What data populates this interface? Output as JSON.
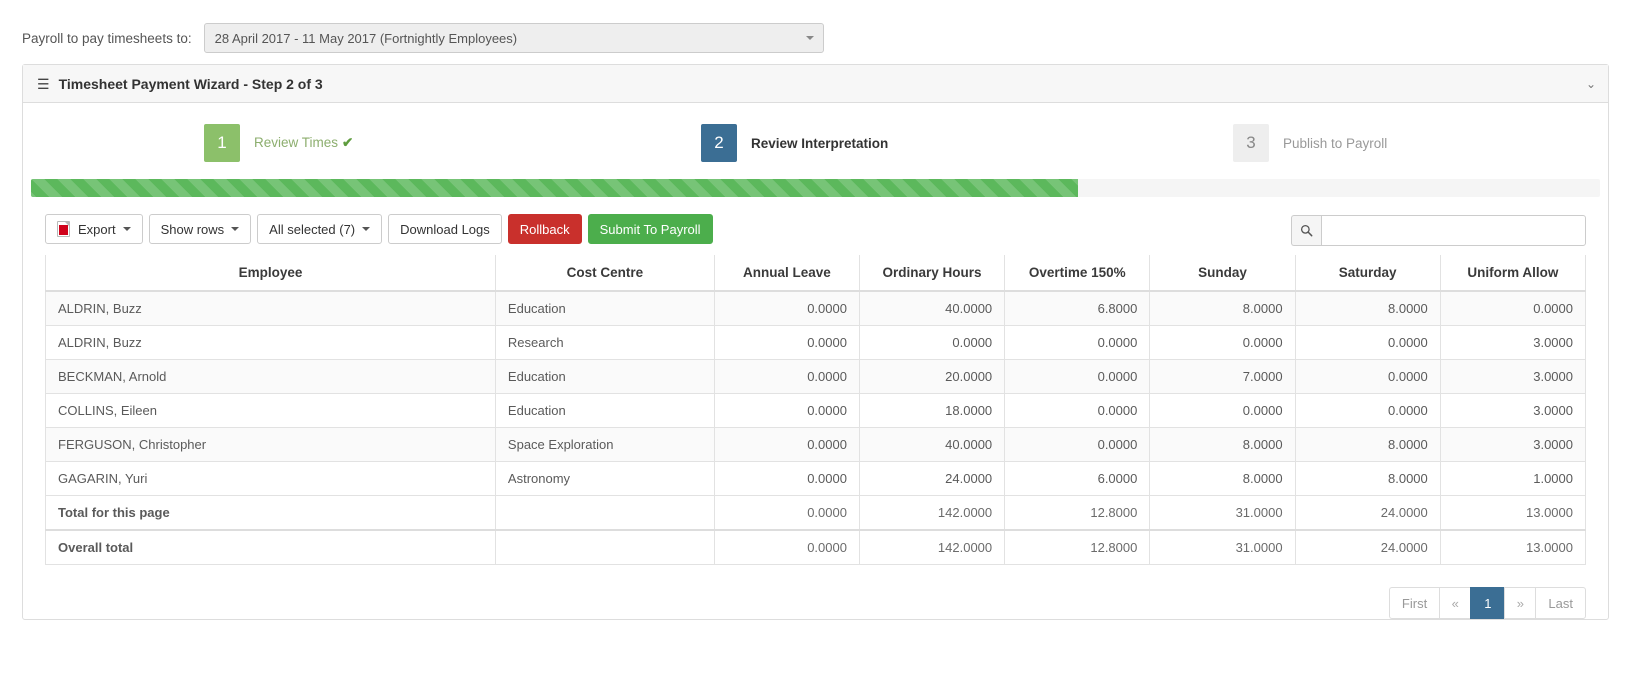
{
  "payroll": {
    "label": "Payroll to pay timesheets to:",
    "selected": "28 April 2017 - 11 May 2017 (Fortnightly Employees)"
  },
  "panel": {
    "title": "Timesheet Payment Wizard - Step 2 of 3",
    "menu_icon": "☰",
    "collapse_icon": "⌄"
  },
  "steps": [
    {
      "number": "1",
      "label": "Review Times",
      "check": "✔"
    },
    {
      "number": "2",
      "label": "Review Interpretation",
      "check": ""
    },
    {
      "number": "3",
      "label": "Publish to Payroll",
      "check": ""
    }
  ],
  "progress": {
    "percent": 66.7
  },
  "toolbar": {
    "export_label": "Export",
    "show_rows_label": "Show rows",
    "all_selected_label": "All selected (7)",
    "download_logs_label": "Download Logs",
    "rollback_label": "Rollback",
    "submit_label": "Submit To Payroll"
  },
  "search": {
    "value": "",
    "placeholder": "",
    "icon": "search-icon"
  },
  "table": {
    "headers": [
      "Employee",
      "Cost Centre",
      "Annual Leave",
      "Ordinary Hours",
      "Overtime 150%",
      "Sunday",
      "Saturday",
      "Uniform Allow"
    ],
    "rows": [
      {
        "employee": "ALDRIN, Buzz",
        "cost_centre": "Education",
        "annual_leave": "0.0000",
        "ordinary_hours": "40.0000",
        "overtime_150": "6.8000",
        "sunday": "8.0000",
        "saturday": "8.0000",
        "uniform_allow": "0.0000"
      },
      {
        "employee": "ALDRIN, Buzz",
        "cost_centre": "Research",
        "annual_leave": "0.0000",
        "ordinary_hours": "0.0000",
        "overtime_150": "0.0000",
        "sunday": "0.0000",
        "saturday": "0.0000",
        "uniform_allow": "3.0000"
      },
      {
        "employee": "BECKMAN, Arnold",
        "cost_centre": "Education",
        "annual_leave": "0.0000",
        "ordinary_hours": "20.0000",
        "overtime_150": "0.0000",
        "sunday": "7.0000",
        "saturday": "0.0000",
        "uniform_allow": "3.0000"
      },
      {
        "employee": "COLLINS, Eileen",
        "cost_centre": "Education",
        "annual_leave": "0.0000",
        "ordinary_hours": "18.0000",
        "overtime_150": "0.0000",
        "sunday": "0.0000",
        "saturday": "0.0000",
        "uniform_allow": "3.0000"
      },
      {
        "employee": "FERGUSON, Christopher",
        "cost_centre": "Space Exploration",
        "annual_leave": "0.0000",
        "ordinary_hours": "40.0000",
        "overtime_150": "0.0000",
        "sunday": "8.0000",
        "saturday": "8.0000",
        "uniform_allow": "3.0000"
      },
      {
        "employee": "GAGARIN, Yuri",
        "cost_centre": "Astronomy",
        "annual_leave": "0.0000",
        "ordinary_hours": "24.0000",
        "overtime_150": "6.0000",
        "sunday": "8.0000",
        "saturday": "8.0000",
        "uniform_allow": "1.0000"
      }
    ],
    "totals": [
      {
        "label": "Total for this page",
        "cost_centre": "",
        "annual_leave": "0.0000",
        "ordinary_hours": "142.0000",
        "overtime_150": "12.8000",
        "sunday": "31.0000",
        "saturday": "24.0000",
        "uniform_allow": "13.0000"
      },
      {
        "label": "Overall total",
        "cost_centre": "",
        "annual_leave": "0.0000",
        "ordinary_hours": "142.0000",
        "overtime_150": "12.8000",
        "sunday": "31.0000",
        "saturday": "24.0000",
        "uniform_allow": "13.0000"
      }
    ]
  },
  "pagination": {
    "first": "First",
    "prev": "«",
    "pages": [
      "1"
    ],
    "next": "»",
    "last": "Last",
    "active_page": "1"
  },
  "colors": {
    "step_done": "#8cc06a",
    "step_active": "#3b6e94",
    "step_pending": "#eeeeee",
    "progress": "#5cb85c",
    "danger": "#c9302c",
    "success": "#4cae4c"
  }
}
